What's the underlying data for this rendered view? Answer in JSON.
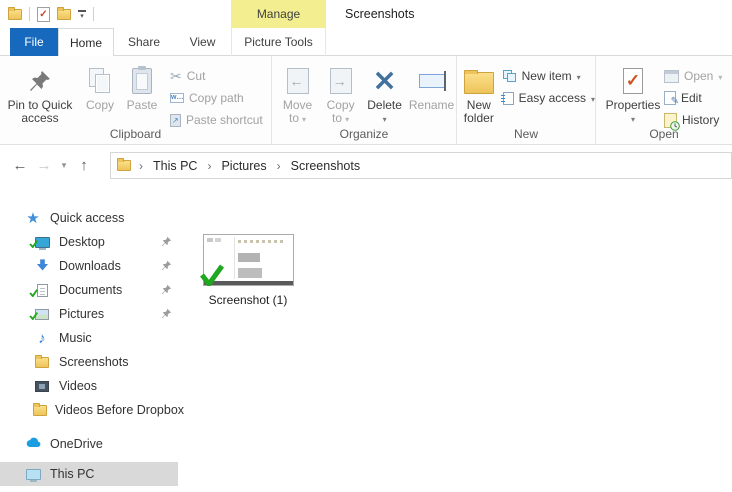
{
  "colors": {
    "file_tab_blue": "#1669bc",
    "manage_tab_yellow": "#f3ef90",
    "selection_gray": "#d9d9d9",
    "sync_check_green": "#1fa81f",
    "delete_x_blue": "#41719c"
  },
  "titlebar": {
    "title": "Screenshots",
    "contextual_tab_header": "Manage"
  },
  "tabs": {
    "file": "File",
    "home": "Home",
    "share": "Share",
    "view": "View",
    "picture_tools": "Picture Tools",
    "active": "Home"
  },
  "ribbon": {
    "clipboard": {
      "label": "Clipboard",
      "pin": {
        "lines": [
          "Pin to Quick",
          "access"
        ],
        "enabled": true
      },
      "copy": {
        "label": "Copy",
        "enabled": false
      },
      "paste": {
        "label": "Paste",
        "enabled": false
      },
      "cut": {
        "label": "Cut",
        "enabled": false
      },
      "copy_path": {
        "label": "Copy path",
        "enabled": false
      },
      "paste_shortcut": {
        "label": "Paste shortcut",
        "enabled": false
      }
    },
    "organize": {
      "label": "Organize",
      "move_to": {
        "lines": [
          "Move",
          "to"
        ],
        "enabled": false,
        "dropdown": true
      },
      "copy_to": {
        "lines": [
          "Copy",
          "to"
        ],
        "enabled": false,
        "dropdown": true
      },
      "delete": {
        "label": "Delete",
        "enabled": true,
        "dropdown": true
      },
      "rename": {
        "label": "Rename",
        "enabled": false
      }
    },
    "new": {
      "label": "New",
      "new_folder": {
        "lines": [
          "New",
          "folder"
        ],
        "enabled": true
      },
      "new_item": {
        "label": "New item",
        "enabled": true,
        "dropdown": true
      },
      "easy_access": {
        "label": "Easy access",
        "enabled": true,
        "dropdown": true
      }
    },
    "open": {
      "label": "Open",
      "properties": {
        "label": "Properties",
        "enabled": true,
        "dropdown": true
      },
      "open": {
        "label": "Open",
        "enabled": false,
        "dropdown": true
      },
      "edit": {
        "label": "Edit",
        "enabled": true
      },
      "history": {
        "label": "History",
        "enabled": true
      }
    }
  },
  "addressbar": {
    "crumbs": [
      "This PC",
      "Pictures",
      "Screenshots"
    ]
  },
  "sidebar": {
    "items": [
      {
        "label": "Quick access",
        "icon": "quick-access-star-icon",
        "pinned": false
      },
      {
        "label": "Desktop",
        "icon": "desktop-icon",
        "pinned": true
      },
      {
        "label": "Downloads",
        "icon": "downloads-icon",
        "pinned": true
      },
      {
        "label": "Documents",
        "icon": "documents-icon",
        "pinned": true
      },
      {
        "label": "Pictures",
        "icon": "pictures-icon",
        "pinned": true
      },
      {
        "label": "Music",
        "icon": "music-icon",
        "pinned": false
      },
      {
        "label": "Screenshots",
        "icon": "folder-icon",
        "pinned": false
      },
      {
        "label": "Videos",
        "icon": "videos-icon",
        "pinned": false
      },
      {
        "label": "Videos Before Dropbox",
        "icon": "folder-icon",
        "pinned": false
      },
      {
        "label": "OneDrive",
        "icon": "onedrive-icon",
        "pinned": false
      },
      {
        "label": "This PC",
        "icon": "this-pc-icon",
        "pinned": false,
        "selected": true
      }
    ]
  },
  "content": {
    "files": [
      {
        "name": "Screenshot (1)",
        "synced": true
      }
    ]
  }
}
